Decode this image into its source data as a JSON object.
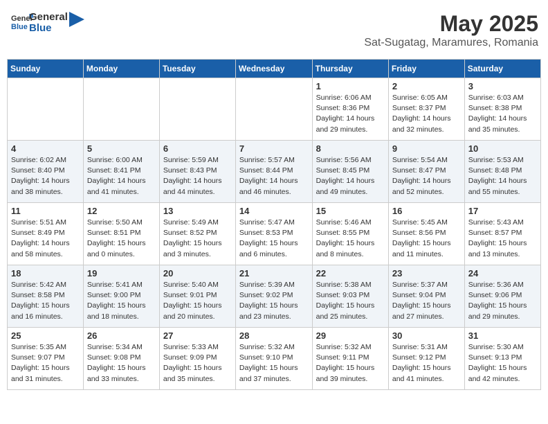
{
  "header": {
    "logo_general": "General",
    "logo_blue": "Blue",
    "title": "May 2025",
    "subtitle": "Sat-Sugatag, Maramures, Romania"
  },
  "weekdays": [
    "Sunday",
    "Monday",
    "Tuesday",
    "Wednesday",
    "Thursday",
    "Friday",
    "Saturday"
  ],
  "weeks": [
    [
      {
        "day": "",
        "info": ""
      },
      {
        "day": "",
        "info": ""
      },
      {
        "day": "",
        "info": ""
      },
      {
        "day": "",
        "info": ""
      },
      {
        "day": "1",
        "info": "Sunrise: 6:06 AM\nSunset: 8:36 PM\nDaylight: 14 hours\nand 29 minutes."
      },
      {
        "day": "2",
        "info": "Sunrise: 6:05 AM\nSunset: 8:37 PM\nDaylight: 14 hours\nand 32 minutes."
      },
      {
        "day": "3",
        "info": "Sunrise: 6:03 AM\nSunset: 8:38 PM\nDaylight: 14 hours\nand 35 minutes."
      }
    ],
    [
      {
        "day": "4",
        "info": "Sunrise: 6:02 AM\nSunset: 8:40 PM\nDaylight: 14 hours\nand 38 minutes."
      },
      {
        "day": "5",
        "info": "Sunrise: 6:00 AM\nSunset: 8:41 PM\nDaylight: 14 hours\nand 41 minutes."
      },
      {
        "day": "6",
        "info": "Sunrise: 5:59 AM\nSunset: 8:43 PM\nDaylight: 14 hours\nand 44 minutes."
      },
      {
        "day": "7",
        "info": "Sunrise: 5:57 AM\nSunset: 8:44 PM\nDaylight: 14 hours\nand 46 minutes."
      },
      {
        "day": "8",
        "info": "Sunrise: 5:56 AM\nSunset: 8:45 PM\nDaylight: 14 hours\nand 49 minutes."
      },
      {
        "day": "9",
        "info": "Sunrise: 5:54 AM\nSunset: 8:47 PM\nDaylight: 14 hours\nand 52 minutes."
      },
      {
        "day": "10",
        "info": "Sunrise: 5:53 AM\nSunset: 8:48 PM\nDaylight: 14 hours\nand 55 minutes."
      }
    ],
    [
      {
        "day": "11",
        "info": "Sunrise: 5:51 AM\nSunset: 8:49 PM\nDaylight: 14 hours\nand 58 minutes."
      },
      {
        "day": "12",
        "info": "Sunrise: 5:50 AM\nSunset: 8:51 PM\nDaylight: 15 hours\nand 0 minutes."
      },
      {
        "day": "13",
        "info": "Sunrise: 5:49 AM\nSunset: 8:52 PM\nDaylight: 15 hours\nand 3 minutes."
      },
      {
        "day": "14",
        "info": "Sunrise: 5:47 AM\nSunset: 8:53 PM\nDaylight: 15 hours\nand 6 minutes."
      },
      {
        "day": "15",
        "info": "Sunrise: 5:46 AM\nSunset: 8:55 PM\nDaylight: 15 hours\nand 8 minutes."
      },
      {
        "day": "16",
        "info": "Sunrise: 5:45 AM\nSunset: 8:56 PM\nDaylight: 15 hours\nand 11 minutes."
      },
      {
        "day": "17",
        "info": "Sunrise: 5:43 AM\nSunset: 8:57 PM\nDaylight: 15 hours\nand 13 minutes."
      }
    ],
    [
      {
        "day": "18",
        "info": "Sunrise: 5:42 AM\nSunset: 8:58 PM\nDaylight: 15 hours\nand 16 minutes."
      },
      {
        "day": "19",
        "info": "Sunrise: 5:41 AM\nSunset: 9:00 PM\nDaylight: 15 hours\nand 18 minutes."
      },
      {
        "day": "20",
        "info": "Sunrise: 5:40 AM\nSunset: 9:01 PM\nDaylight: 15 hours\nand 20 minutes."
      },
      {
        "day": "21",
        "info": "Sunrise: 5:39 AM\nSunset: 9:02 PM\nDaylight: 15 hours\nand 23 minutes."
      },
      {
        "day": "22",
        "info": "Sunrise: 5:38 AM\nSunset: 9:03 PM\nDaylight: 15 hours\nand 25 minutes."
      },
      {
        "day": "23",
        "info": "Sunrise: 5:37 AM\nSunset: 9:04 PM\nDaylight: 15 hours\nand 27 minutes."
      },
      {
        "day": "24",
        "info": "Sunrise: 5:36 AM\nSunset: 9:06 PM\nDaylight: 15 hours\nand 29 minutes."
      }
    ],
    [
      {
        "day": "25",
        "info": "Sunrise: 5:35 AM\nSunset: 9:07 PM\nDaylight: 15 hours\nand 31 minutes."
      },
      {
        "day": "26",
        "info": "Sunrise: 5:34 AM\nSunset: 9:08 PM\nDaylight: 15 hours\nand 33 minutes."
      },
      {
        "day": "27",
        "info": "Sunrise: 5:33 AM\nSunset: 9:09 PM\nDaylight: 15 hours\nand 35 minutes."
      },
      {
        "day": "28",
        "info": "Sunrise: 5:32 AM\nSunset: 9:10 PM\nDaylight: 15 hours\nand 37 minutes."
      },
      {
        "day": "29",
        "info": "Sunrise: 5:32 AM\nSunset: 9:11 PM\nDaylight: 15 hours\nand 39 minutes."
      },
      {
        "day": "30",
        "info": "Sunrise: 5:31 AM\nSunset: 9:12 PM\nDaylight: 15 hours\nand 41 minutes."
      },
      {
        "day": "31",
        "info": "Sunrise: 5:30 AM\nSunset: 9:13 PM\nDaylight: 15 hours\nand 42 minutes."
      }
    ]
  ]
}
